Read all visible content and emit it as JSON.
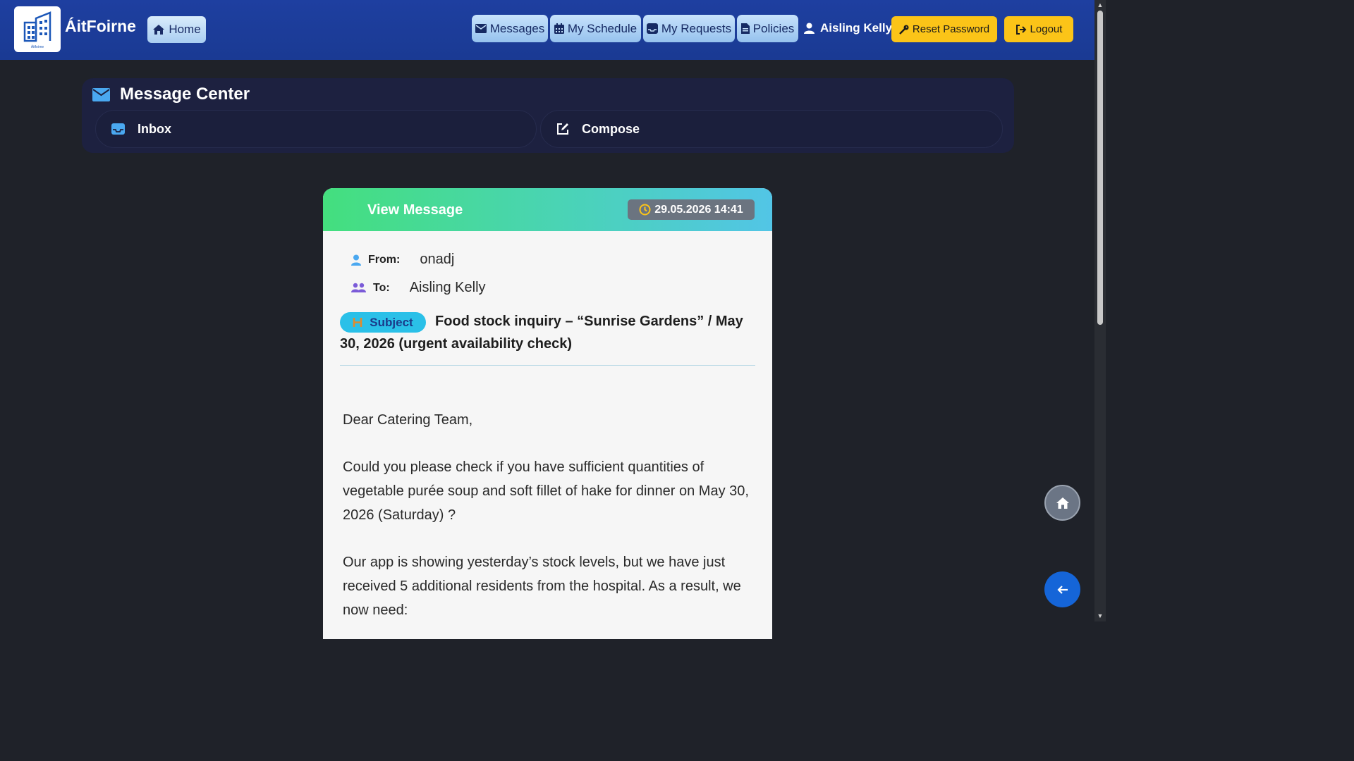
{
  "app": {
    "brand": "ÁitFoirne",
    "logo_caption": "Áitfoirne"
  },
  "nav": {
    "home": "Home",
    "messages": "Messages",
    "schedule": "My Schedule",
    "requests": "My Requests",
    "policies": "Policies",
    "user": "Aisling Kelly",
    "reset_password": "Reset Password",
    "logout": "Logout"
  },
  "message_center": {
    "title": "Message Center",
    "tabs": {
      "inbox": "Inbox",
      "compose": "Compose"
    }
  },
  "message": {
    "header_title": "View Message",
    "date": "29.05.2026 14:41",
    "from_label": "From:",
    "from_value": "onadj",
    "to_label": "To:",
    "to_value": "Aisling Kelly",
    "subject_label": "Subject",
    "subject_text": "Food stock inquiry – “Sunrise Gardens” / May 30, 2026 (urgent availability check)",
    "body": [
      "Dear Catering Team,",
      "Could you please check if you have sufficient quantities of vegetable purée soup and soft fillet of hake for dinner on May 30, 2026 (Saturday) ?",
      "Our app is showing yesterday’s stock levels, but we have just received 5 additional residents from the hospital. As a result, we now need:"
    ]
  },
  "colors": {
    "nav_bg": "#1e3fa0",
    "accent_yellow": "#fbc418",
    "card_header_start": "#44df7e",
    "card_header_end": "#52c5e6",
    "fab_back": "#1565d8"
  },
  "icons": {
    "home": "home-icon",
    "messages": "envelope-icon",
    "schedule": "calendar-icon",
    "requests": "inbox-icon",
    "policies": "document-icon",
    "user": "user-icon",
    "reset": "key-icon",
    "logout": "logout-icon",
    "clock": "clock-icon",
    "to": "users-icon",
    "subject": "heading-icon",
    "compose": "edit-icon",
    "back": "arrow-left-icon"
  }
}
